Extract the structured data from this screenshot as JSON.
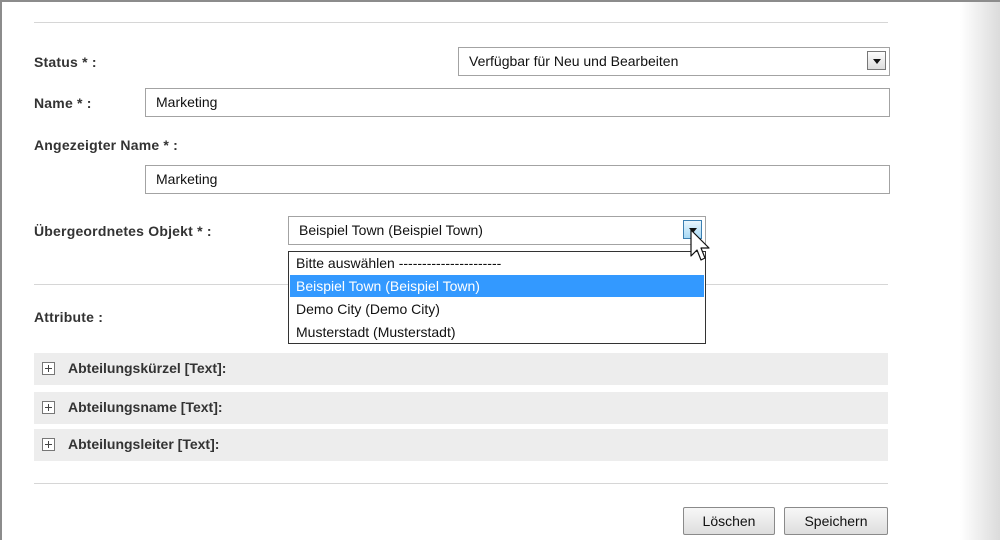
{
  "form": {
    "status": {
      "label": "Status * :",
      "value": "Verfügbar für Neu und Bearbeiten"
    },
    "name": {
      "label": "Name * :",
      "value": "Marketing"
    },
    "display_name": {
      "label": "Angezeigter Name * :",
      "value": "Marketing"
    },
    "parent": {
      "label": "Übergeordnetes Objekt * :",
      "value": "Beispiel Town (Beispiel Town)",
      "options": [
        "Bitte auswählen ----------------------",
        "Beispiel Town (Beispiel Town)",
        "Demo City (Demo City)",
        "Musterstadt (Musterstadt)"
      ],
      "selected_index": 1
    },
    "attributes": {
      "label": "Attribute :",
      "items": [
        "Abteilungskürzel [Text]:",
        "Abteilungsname [Text]:",
        "Abteilungsleiter [Text]:"
      ]
    }
  },
  "buttons": {
    "delete": "Löschen",
    "save": "Speichern"
  },
  "icons": {
    "dropdown_arrow": "chevron-down-icon",
    "expand": "plus-icon",
    "cursor": "mouse-pointer-icon"
  },
  "colors": {
    "highlight": "#3399ff",
    "attribute_row_bg": "#ededed"
  }
}
